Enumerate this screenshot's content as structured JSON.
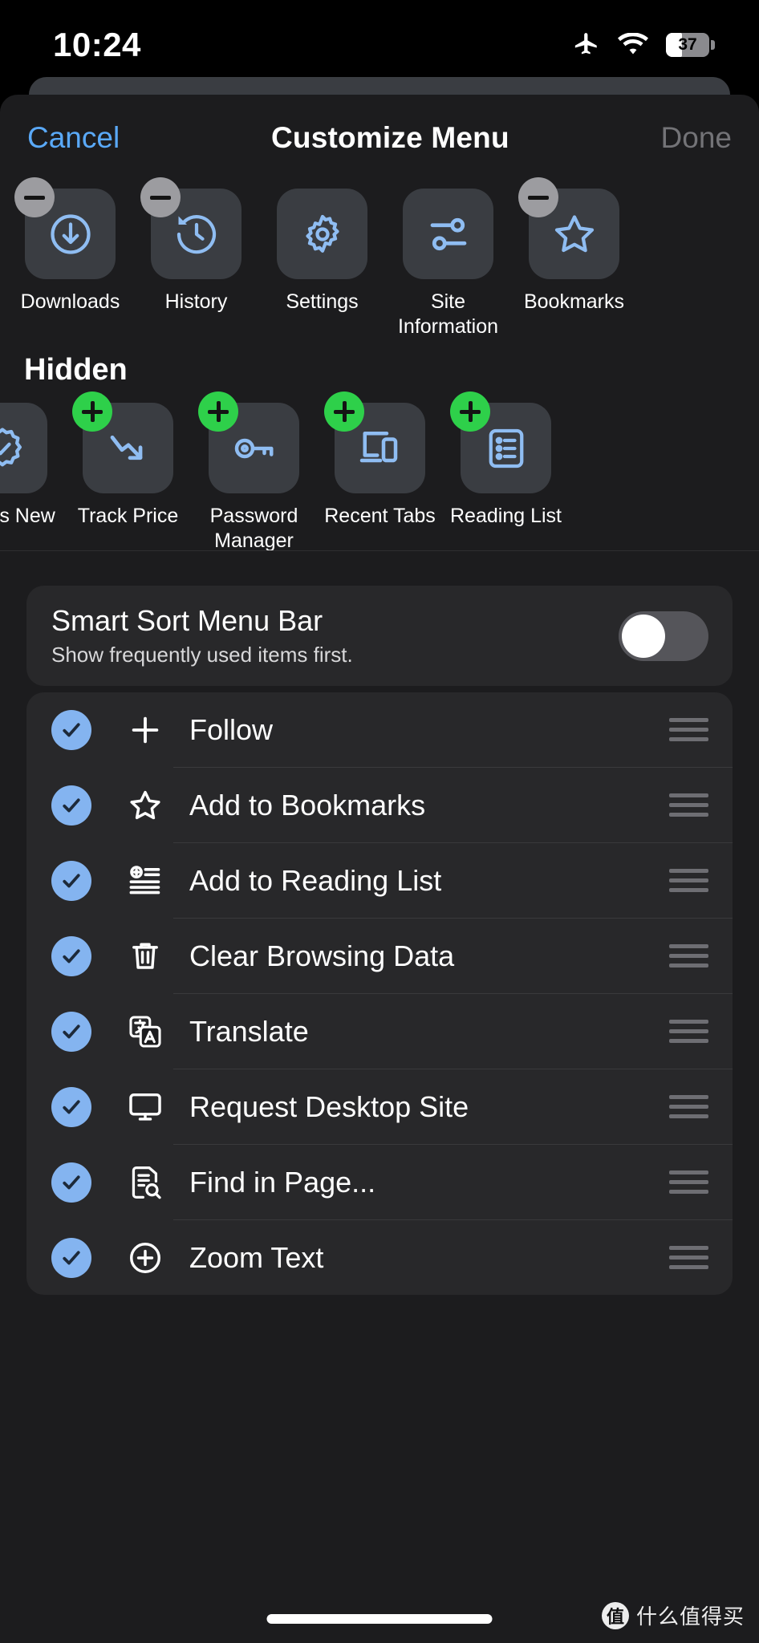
{
  "status_bar": {
    "time": "10:24",
    "airplane_icon": "airplane-icon",
    "wifi_icon": "wifi-icon",
    "battery_percent": "37"
  },
  "nav": {
    "cancel_label": "Cancel",
    "title": "Customize Menu",
    "done_label": "Done"
  },
  "visible_section": {
    "items": [
      {
        "label": "Downloads",
        "icon": "download-circle-icon",
        "badge": "minus"
      },
      {
        "label": "History",
        "icon": "history-clock-icon",
        "badge": "minus"
      },
      {
        "label": "Settings",
        "icon": "gear-icon",
        "badge": "none"
      },
      {
        "label": "Site Information",
        "icon": "sliders-icon",
        "badge": "none"
      },
      {
        "label": "Bookmarks",
        "icon": "star-icon",
        "badge": "minus"
      }
    ]
  },
  "hidden_section": {
    "title": "Hidden",
    "items": [
      {
        "label": "What's New",
        "icon": "badge-check-icon",
        "badge": "none"
      },
      {
        "label": "Track Price",
        "icon": "trend-down-icon",
        "badge": "plus"
      },
      {
        "label": "Password Manager",
        "icon": "key-icon",
        "badge": "plus"
      },
      {
        "label": "Recent Tabs",
        "icon": "devices-icon",
        "badge": "plus"
      },
      {
        "label": "Reading List",
        "icon": "reading-list-icon",
        "badge": "plus"
      }
    ]
  },
  "smart_sort": {
    "title": "Smart Sort Menu Bar",
    "subtitle": "Show frequently used items first.",
    "toggle_state": "off"
  },
  "menu_items": [
    {
      "label": "Follow",
      "icon": "plus-icon",
      "checked": true
    },
    {
      "label": "Add to Bookmarks",
      "icon": "star-icon",
      "checked": true
    },
    {
      "label": "Add to Reading List",
      "icon": "add-list-icon",
      "checked": true
    },
    {
      "label": "Clear Browsing Data",
      "icon": "trash-icon",
      "checked": true
    },
    {
      "label": "Translate",
      "icon": "translate-icon",
      "checked": true
    },
    {
      "label": "Request Desktop Site",
      "icon": "desktop-icon",
      "checked": true
    },
    {
      "label": "Find in Page...",
      "icon": "find-in-page-icon",
      "checked": true
    },
    {
      "label": "Zoom Text",
      "icon": "zoom-text-icon",
      "checked": true
    }
  ],
  "watermark": {
    "badge": "值",
    "text": "什么值得买"
  },
  "colors": {
    "accent_blue": "#5aa9f8",
    "icon_blue": "#8fbdf2",
    "check_blue": "#84b4f0",
    "add_green": "#2ed04a",
    "remove_gray": "#9c9ca0",
    "sheet_bg": "#1c1c1e",
    "card_bg": "#28282a",
    "tile_bg": "#3a3d42"
  }
}
